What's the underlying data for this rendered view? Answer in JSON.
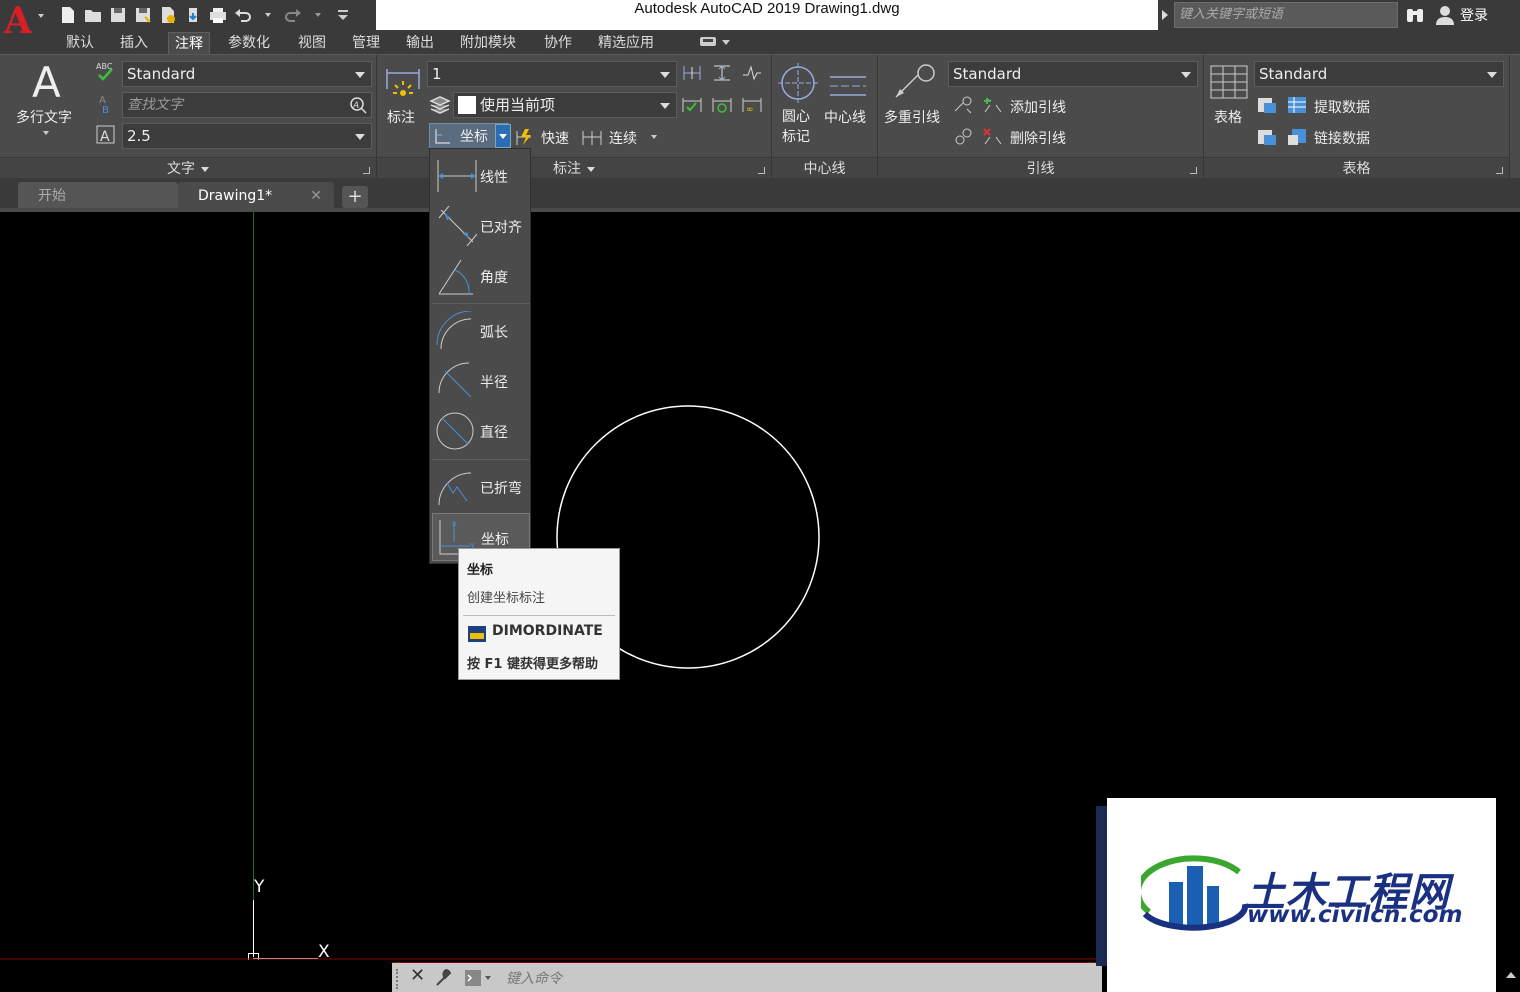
{
  "window": {
    "title": "Autodesk AutoCAD 2019    Drawing1.dwg",
    "search_placeholder": "键入关键字或短语",
    "login": "登录"
  },
  "menu_tabs": [
    "默认",
    "插入",
    "注释",
    "参数化",
    "视图",
    "管理",
    "输出",
    "附加模块",
    "协作",
    "精选应用"
  ],
  "active_tab": "注释",
  "ribbon": {
    "text_panel": {
      "title": "文字",
      "mtext_label": "多行文字",
      "text_style": "Standard",
      "find_placeholder": "查找文字",
      "text_height": "2.5"
    },
    "dim_panel": {
      "title": "标注",
      "dim_button": "标注",
      "dim_style": "1",
      "layer": "使用当前项",
      "current_dim_type": "坐标",
      "quick": "快速",
      "continue": "连续"
    },
    "centerline_panel": {
      "title": "中心线",
      "center_mark": "圆心\n标记",
      "center_mark_line1": "圆心",
      "center_mark_line2": "标记",
      "centerline": "中心线"
    },
    "leader_panel": {
      "title": "引线",
      "multileader": "多重引线",
      "style": "Standard",
      "add_leader": "添加引线",
      "remove_leader": "删除引线"
    },
    "table_panel": {
      "title": "表格",
      "table": "表格",
      "style": "Standard",
      "extract_data": "提取数据",
      "link_data": "链接数据"
    }
  },
  "doc_tabs": {
    "start": "开始",
    "drawing": "Drawing1*"
  },
  "dim_dropdown": {
    "items": [
      "线性",
      "已对齐",
      "角度",
      "弧长",
      "半径",
      "直径",
      "已折弯",
      "坐标"
    ],
    "selected": "坐标"
  },
  "tooltip": {
    "title": "坐标",
    "description": "创建坐标标注",
    "command": "DIMORDINATE",
    "help": "按 F1 键获得更多帮助"
  },
  "ucs": {
    "y_label": "Y",
    "x_label": "X"
  },
  "command_line": {
    "placeholder": "键入命令"
  },
  "watermark": {
    "text": "土木工程网",
    "url": "www.civilcn.com"
  },
  "colors": {
    "ribbon_bg": "#4b4b4b",
    "canvas_bg": "#000000",
    "brand_red": "#d81f26",
    "y_axis_green": "#1f6f2a"
  }
}
